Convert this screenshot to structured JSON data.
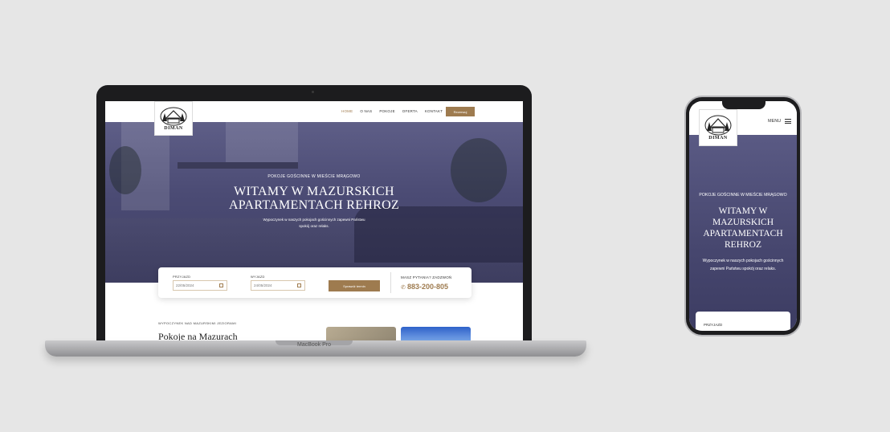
{
  "desktop": {
    "brand": "MacBook Pro",
    "logo_text": "DIMAN",
    "nav": [
      "HOME",
      "O NAS",
      "POKOJE",
      "OFERTA",
      "KONTAKT"
    ],
    "reserve_label": "Rezerwuj",
    "hero": {
      "eyebrow": "POKOJE GOŚCINNE W MIEŚCIE MRĄGOWO",
      "title": "WITAMY W MAZURSKICH APARTAMENTACH REHROZ",
      "subtitle": "Wypoczynek w naszych pokojach gościnnych zapewni Państwu spokój oraz relaks."
    },
    "booking": {
      "arrival_label": "PRZYJAZD",
      "arrival_value": "22/05/2024",
      "departure_label": "WYJAZD",
      "departure_value": "24/05/2024",
      "check_label": "Sprawdź termin",
      "question": "MASZ PYTANIA? ZADZWOŃ",
      "phone": "883-200-805"
    },
    "section": {
      "kicker": "WYPOCZYNEK NAD MAZURSKIMI JEZIORAMI",
      "title": "Pokoje na Mazurach"
    }
  },
  "mobile": {
    "logo_text": "DIMAN",
    "menu_label": "MENU",
    "hero": {
      "eyebrow": "POKOJE GOŚCINNE W MIEŚCIE MRĄGOWO",
      "title": "WITAMY W MAZURSKICH APARTAMENTACH REHROZ",
      "subtitle": "Wypoczynek w naszych pokojach gościnnych zapewni Państwu spokój oraz relaks."
    },
    "booking_label": "PRZYJAZD"
  },
  "colors": {
    "accent": "#9e7b4f",
    "hero_overlay": "#4b4b74",
    "background": "#e6e6e6"
  }
}
